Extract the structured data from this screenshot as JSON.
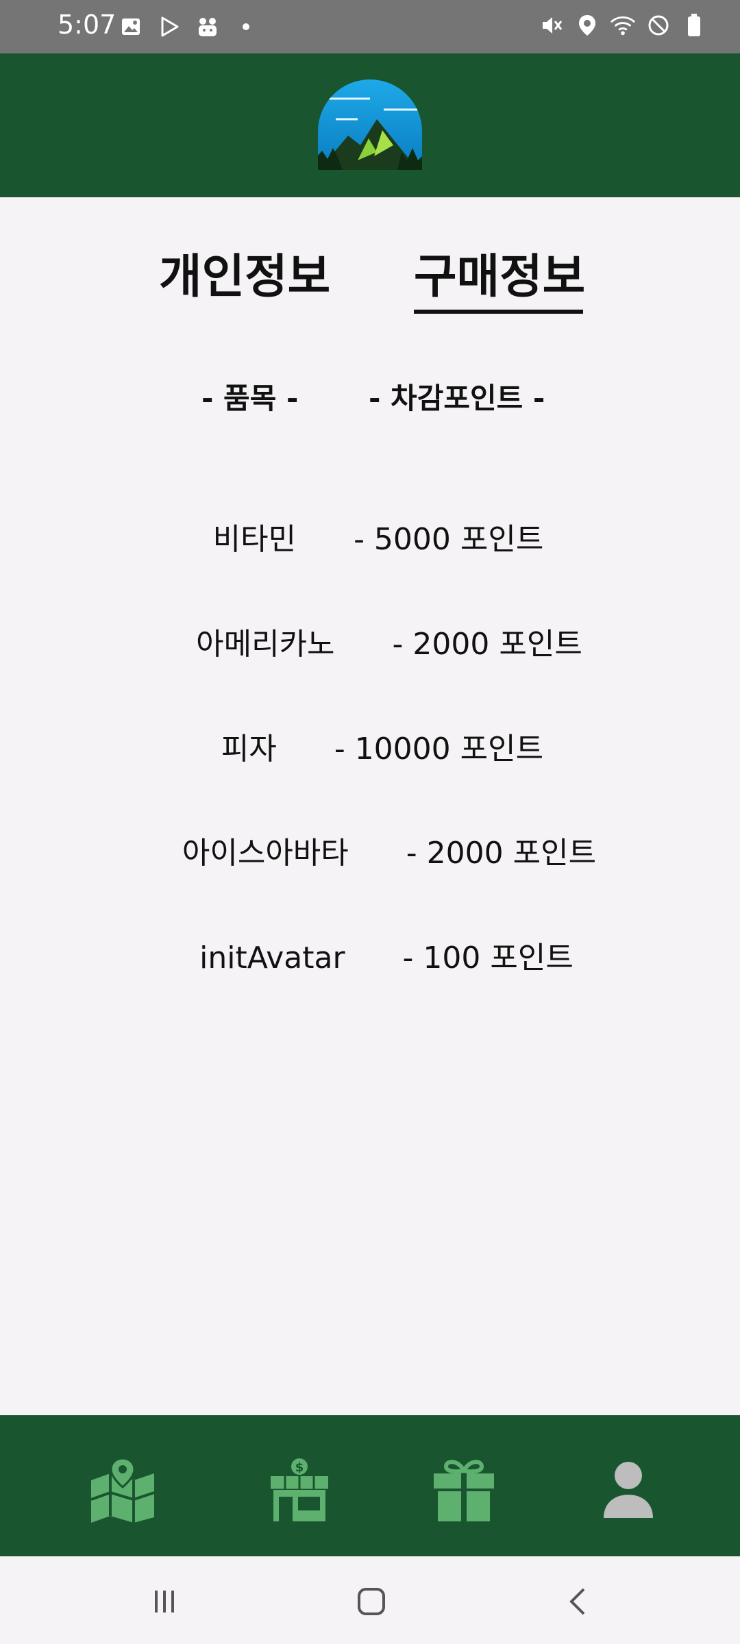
{
  "status_bar": {
    "time": "5:07",
    "left_icons": [
      "image-icon",
      "play-store-icon",
      "app-notification-icon",
      "dot-icon"
    ],
    "right_icons": [
      "mute-icon",
      "location-icon",
      "wifi-icon",
      "do-not-disturb-icon",
      "battery-icon"
    ]
  },
  "header": {
    "logo": "mountain-logo"
  },
  "tabs": [
    {
      "label": "개인정보",
      "selected": false
    },
    {
      "label": "구매정보",
      "selected": true
    }
  ],
  "purchase_list": {
    "headers": {
      "item": "- 품목 -",
      "points": "- 차감포인트 -"
    },
    "rows": [
      {
        "item": "비타민",
        "points": "- 5000 포인트"
      },
      {
        "item": "아메리카노",
        "points": "- 2000 포인트"
      },
      {
        "item": "피자",
        "points": "- 10000 포인트"
      },
      {
        "item": "아이스아바타",
        "points": "- 2000 포인트"
      },
      {
        "item": "initAvatar",
        "points": "- 100 포인트"
      }
    ]
  },
  "bottom_nav": {
    "items": [
      "map-icon",
      "store-icon",
      "gift-icon",
      "profile-icon"
    ],
    "active_color": "#bdbdbd",
    "icon_color": "#5eb06e"
  },
  "colors": {
    "header_bg": "#19552f",
    "status_bg": "#757575",
    "page_bg": "#f5f3f5"
  }
}
